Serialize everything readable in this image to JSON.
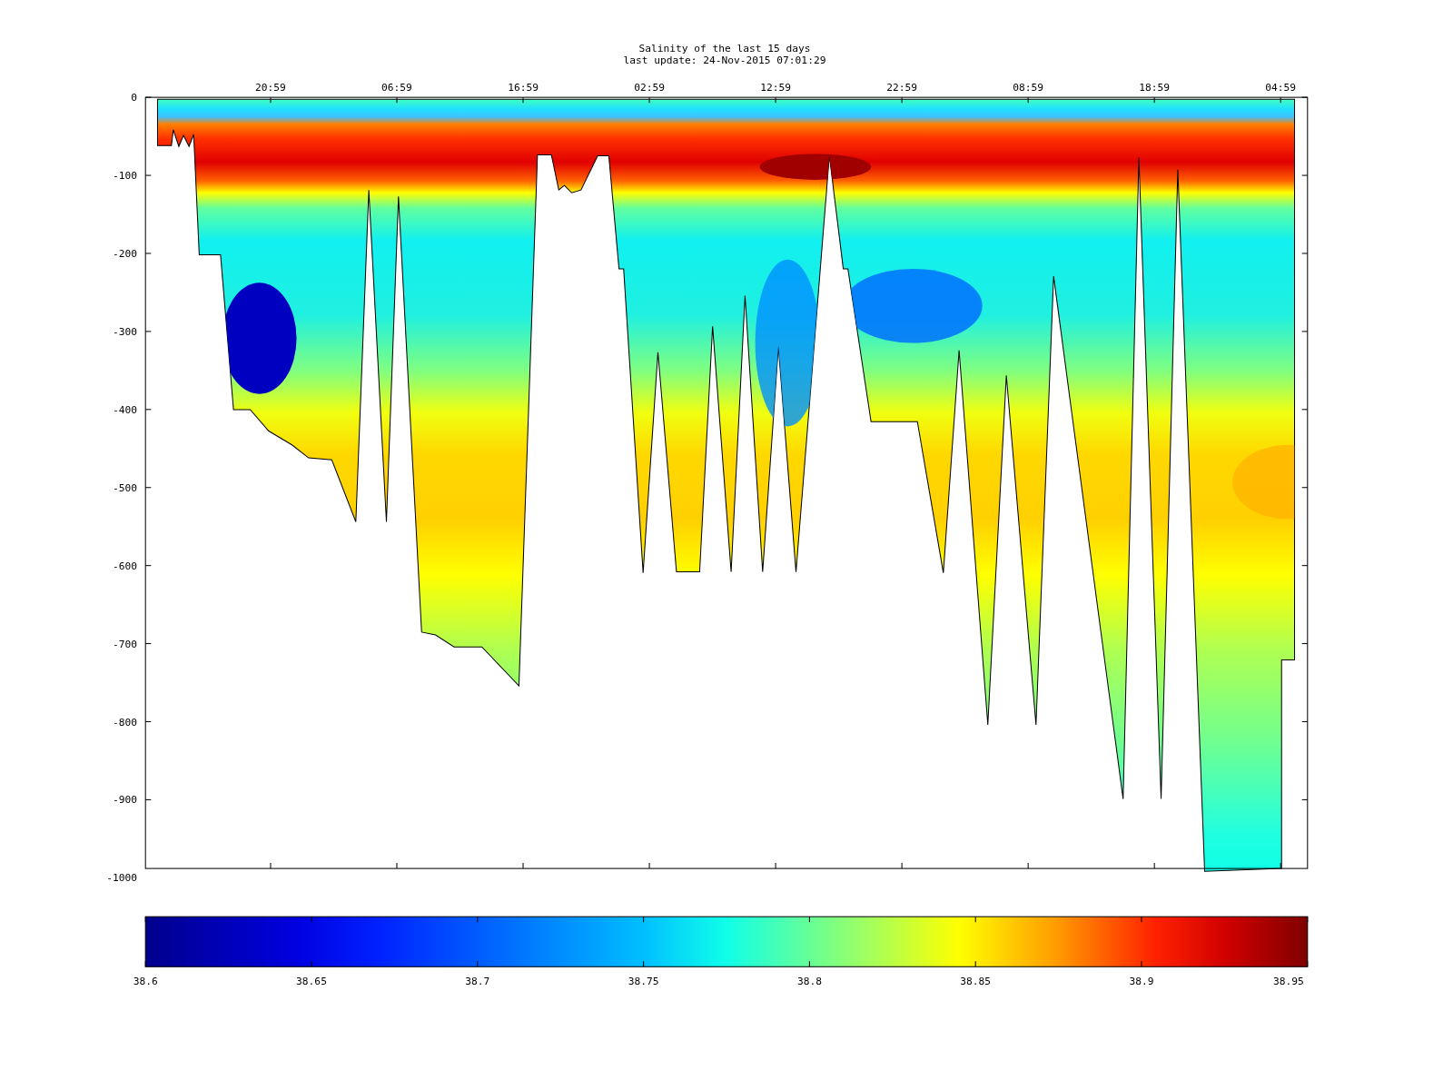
{
  "figure": {
    "title": "Salinity of the last 15 days",
    "subtitle": "last update: 24-Nov-2015 07:01:29",
    "time_ticks": [
      "20:59",
      "06:59",
      "16:59",
      "02:59",
      "12:59",
      "22:59",
      "08:59",
      "18:59",
      "04:59"
    ],
    "depth_ticks": [
      "0",
      "-100",
      "-200",
      "-300",
      "-400",
      "-500",
      "-600",
      "-700",
      "-800",
      "-900",
      "-1000"
    ],
    "colorbar_ticks": [
      "38.6",
      "38.65",
      "38.7",
      "38.75",
      "38.8",
      "38.85",
      "38.9",
      "38.95"
    ]
  }
}
